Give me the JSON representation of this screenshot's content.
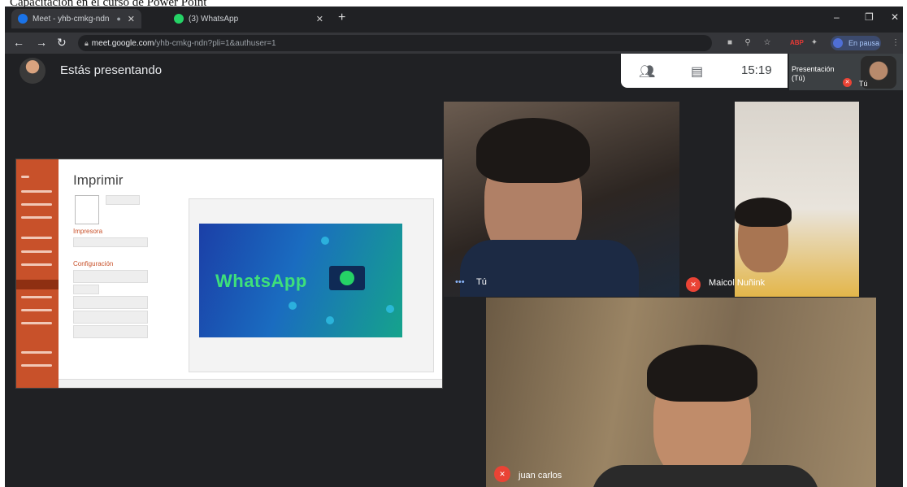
{
  "caption": "Capacitación en el curso de Power Point",
  "tabs": [
    {
      "title": "Meet - yhb-cmkg-ndn",
      "active": true,
      "favicon_color": "#1a73e8"
    },
    {
      "title": "(3) WhatsApp",
      "active": false,
      "favicon_color": "#25d366"
    }
  ],
  "addressbar": {
    "host": "meet.google.com",
    "path": "/yhb-cmkg-ndn?pli=1&authuser=1"
  },
  "profile": {
    "label": "En pausa"
  },
  "window_controls": {
    "minimize": "–",
    "maximize": "❐",
    "close": "✕"
  },
  "meet": {
    "presenting_text": "Estás presentando",
    "time": "15:19",
    "self_tile": {
      "label": "Presentación (Tú)",
      "name": "Tú"
    }
  },
  "shared_screen": {
    "title": "Imprimir",
    "section_printer": "Impresora",
    "section_settings": "Configuración",
    "slide_text": "WhatsApp"
  },
  "participants": [
    {
      "name": "Tú",
      "muted": false
    },
    {
      "name": "Maicol Nuñink",
      "muted": true
    },
    {
      "name": "juan carlos",
      "muted": true
    }
  ],
  "colors": {
    "mic_off": "#ea4335",
    "meet_bg": "#202124",
    "ppt_accent": "#c8512a"
  }
}
